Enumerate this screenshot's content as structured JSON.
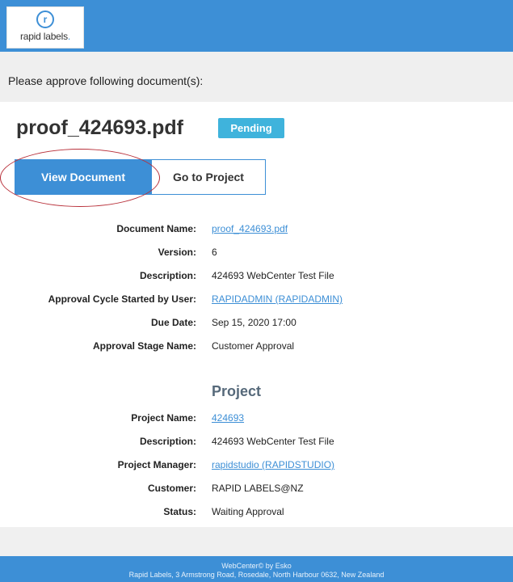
{
  "brand": {
    "mark": "r",
    "name": "rapid labels",
    "dot": "."
  },
  "intro_text": "Please approve following document(s):",
  "document": {
    "title": "proof_424693.pdf",
    "status_badge": "Pending"
  },
  "actions": {
    "view_document": "View Document",
    "go_to_project": "Go to Project"
  },
  "details": [
    {
      "label": "Document Name:",
      "value": "proof_424693.pdf",
      "link": true
    },
    {
      "label": "Version:",
      "value": "6",
      "link": false
    },
    {
      "label": "Description:",
      "value": "424693 WebCenter Test File",
      "link": false
    },
    {
      "label": "Approval Cycle Started by User:",
      "value": "RAPIDADMIN (RAPIDADMIN)",
      "link": true
    },
    {
      "label": "Due Date:",
      "value": "Sep 15, 2020 17:00",
      "link": false
    },
    {
      "label": "Approval Stage Name:",
      "value": "Customer Approval",
      "link": false
    }
  ],
  "project": {
    "heading": "Project",
    "rows": [
      {
        "label": "Project Name:",
        "value": "424693",
        "link": true
      },
      {
        "label": "Description:",
        "value": "424693 WebCenter Test File",
        "link": false
      },
      {
        "label": "Project Manager:",
        "value": "rapidstudio (RAPIDSTUDIO)",
        "link": true
      },
      {
        "label": "Customer:",
        "value": "RAPID LABELS@NZ",
        "link": false
      },
      {
        "label": "Status:",
        "value": "Waiting Approval",
        "link": false
      }
    ]
  },
  "footer": {
    "line1": "WebCenter© by Esko",
    "line2": "Rapid Labels, 3 Armstrong Road, Rosedale, North Harbour 0632, New Zealand"
  },
  "colors": {
    "brand_blue": "#3d8fd6",
    "badge_cyan": "#3fb3dc",
    "annotation_red": "#b8303a"
  }
}
